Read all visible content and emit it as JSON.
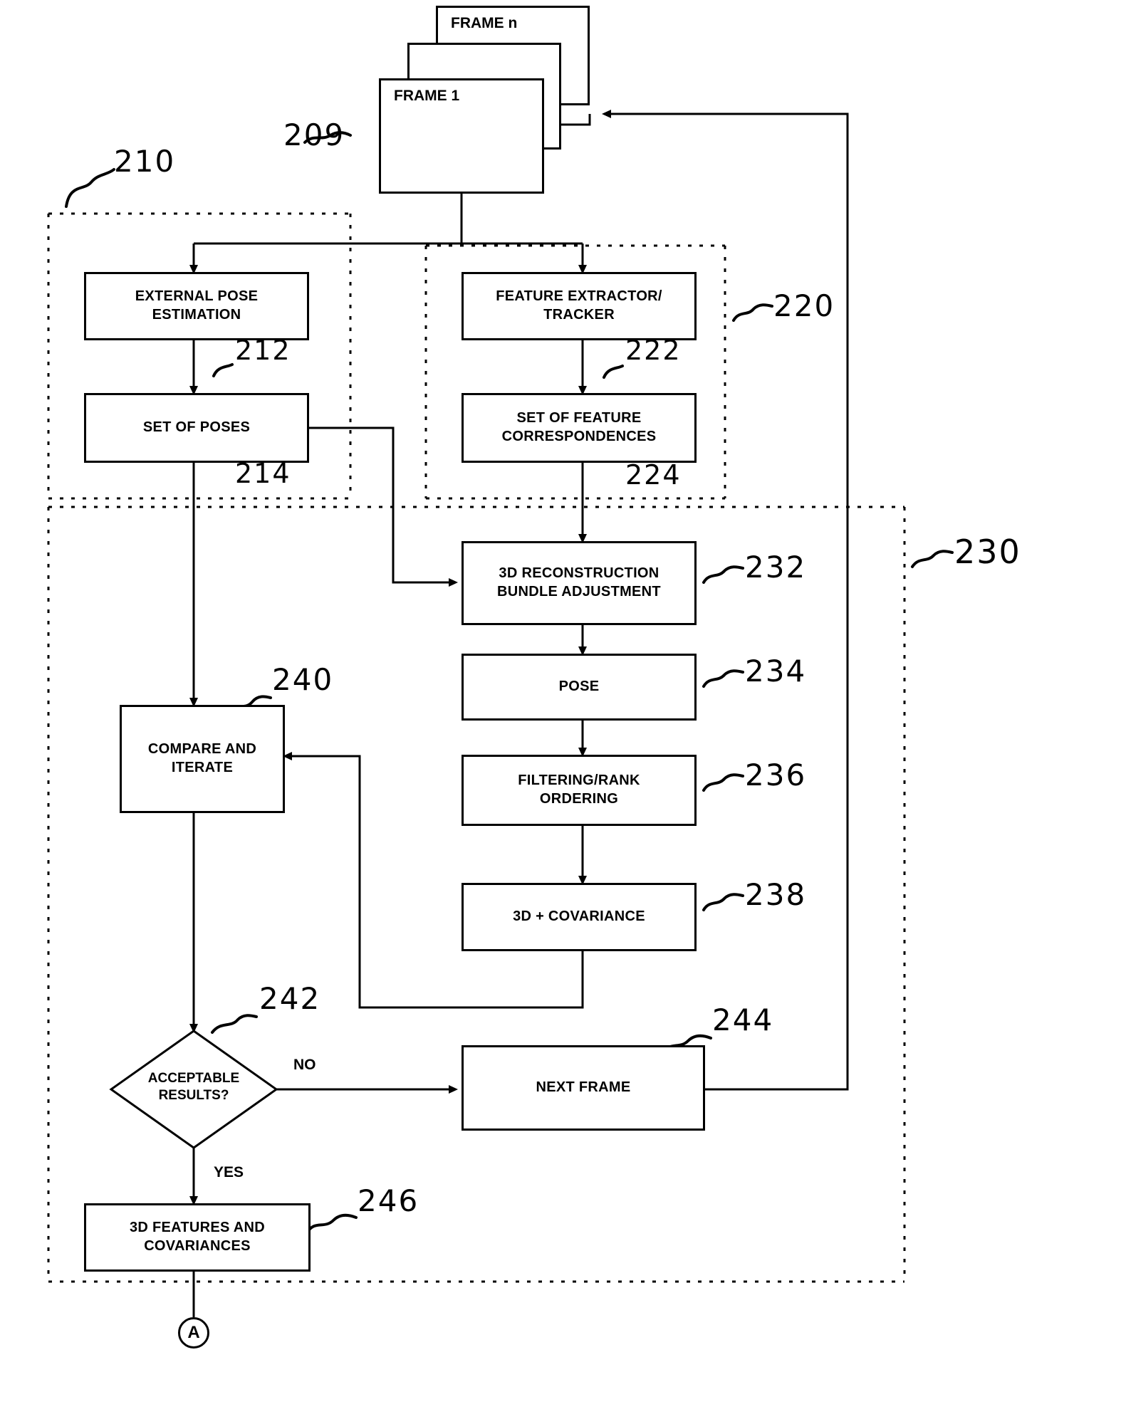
{
  "figure": {
    "type": "patent-flowchart",
    "background": "#ffffff",
    "ink": "#000000"
  },
  "frames": {
    "frame_n_label": "FRAME n",
    "frame_1_label": "FRAME 1",
    "ref": "209"
  },
  "groups": {
    "pose_group_ref": "210",
    "feature_group_ref": "220",
    "reconstruction_group_ref": "230"
  },
  "boxes": [
    {
      "id": "external-pose-estimation",
      "line1": "EXTERNAL POSE",
      "line2": "ESTIMATION",
      "ref": "212"
    },
    {
      "id": "set-of-poses",
      "line1": "SET OF POSES",
      "line2": "",
      "ref": "214"
    },
    {
      "id": "feature-extractor-tracker",
      "line1": "FEATURE EXTRACTOR/",
      "line2": "TRACKER",
      "ref": "222"
    },
    {
      "id": "set-of-feature-correspondences",
      "line1": "SET OF FEATURE",
      "line2": "CORRESPONDENCES",
      "ref": "224"
    },
    {
      "id": "3d-reconstruction-bundle-adjustment",
      "line1": "3D RECONSTRUCTION",
      "line2": "BUNDLE ADJUSTMENT",
      "ref": "232"
    },
    {
      "id": "pose",
      "line1": "POSE",
      "line2": "",
      "ref": "234"
    },
    {
      "id": "filtering-rank-ordering",
      "line1": "FILTERING/RANK",
      "line2": "ORDERING",
      "ref": "236"
    },
    {
      "id": "3d-plus-covariance",
      "line1": "3D + COVARIANCE",
      "line2": "",
      "ref": "238"
    },
    {
      "id": "compare-and-iterate",
      "line1": "COMPARE AND",
      "line2": "ITERATE",
      "ref": "240"
    },
    {
      "id": "next-frame",
      "line1": "NEXT FRAME",
      "line2": "",
      "ref": "244"
    },
    {
      "id": "3d-features-and-covariances",
      "line1": "3D FEATURES AND",
      "line2": "COVARIANCES",
      "ref": "246"
    }
  ],
  "decision": {
    "line1": "ACCEPTABLE",
    "line2": "RESULTS?",
    "ref": "242",
    "branch_no": "NO",
    "branch_yes": "YES"
  },
  "connector": {
    "label": "A"
  },
  "refs": {
    "r209": "209",
    "r210": "210",
    "r212": "212",
    "r214": "214",
    "r220": "220",
    "r222": "222",
    "r224": "224",
    "r230": "230",
    "r232": "232",
    "r234": "234",
    "r236": "236",
    "r238": "238",
    "r240": "240",
    "r242": "242",
    "r244": "244",
    "r246": "246"
  }
}
